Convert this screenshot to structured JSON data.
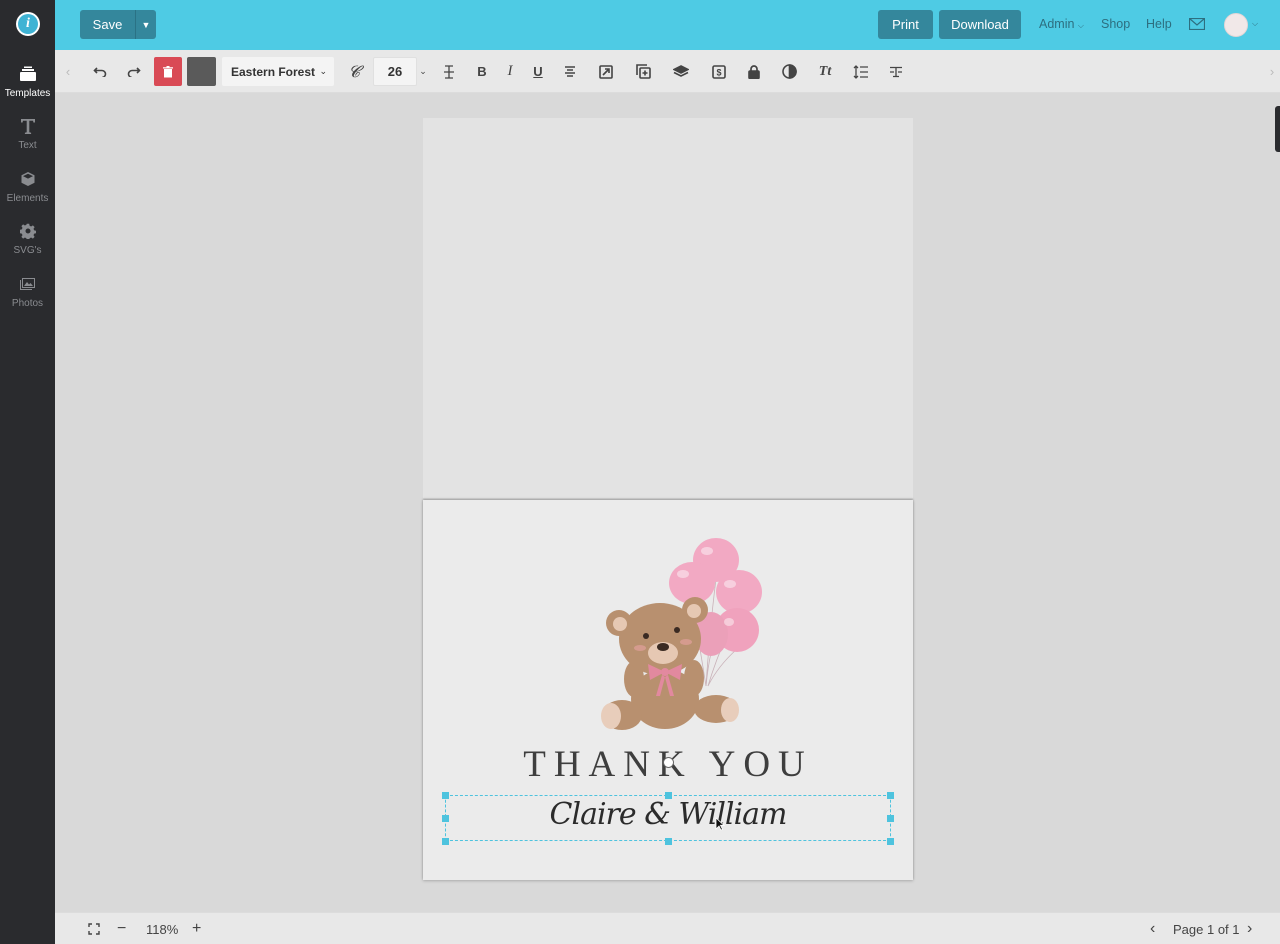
{
  "app": {
    "logo_letter": "i",
    "brand_color": "#4ecbe4",
    "button_color": "#34879c"
  },
  "sidebar": {
    "items": [
      {
        "label": "Templates",
        "icon": "layers-icon",
        "active": true
      },
      {
        "label": "Text",
        "icon": "text-t-icon",
        "active": false
      },
      {
        "label": "Elements",
        "icon": "cube-icon",
        "active": false
      },
      {
        "label": "SVG's",
        "icon": "gear-icon",
        "active": false
      },
      {
        "label": "Photos",
        "icon": "image-icon",
        "active": false
      }
    ]
  },
  "topbar": {
    "save_label": "Save",
    "print_label": "Print",
    "download_label": "Download",
    "admin_label": "Admin",
    "shop_label": "Shop",
    "help_label": "Help"
  },
  "toolbar": {
    "font_name": "Eastern Forest",
    "font_size": "26",
    "delete_color": "#d94a55",
    "text_color": "#5a5a5a"
  },
  "canvas": {
    "heading": "THANK YOU",
    "names": "Claire & William",
    "balloon_color": "#f2a9c3",
    "bear_color": "#b8906f"
  },
  "bottombar": {
    "zoom": "118%",
    "page_indicator": "Page 1 of 1"
  }
}
